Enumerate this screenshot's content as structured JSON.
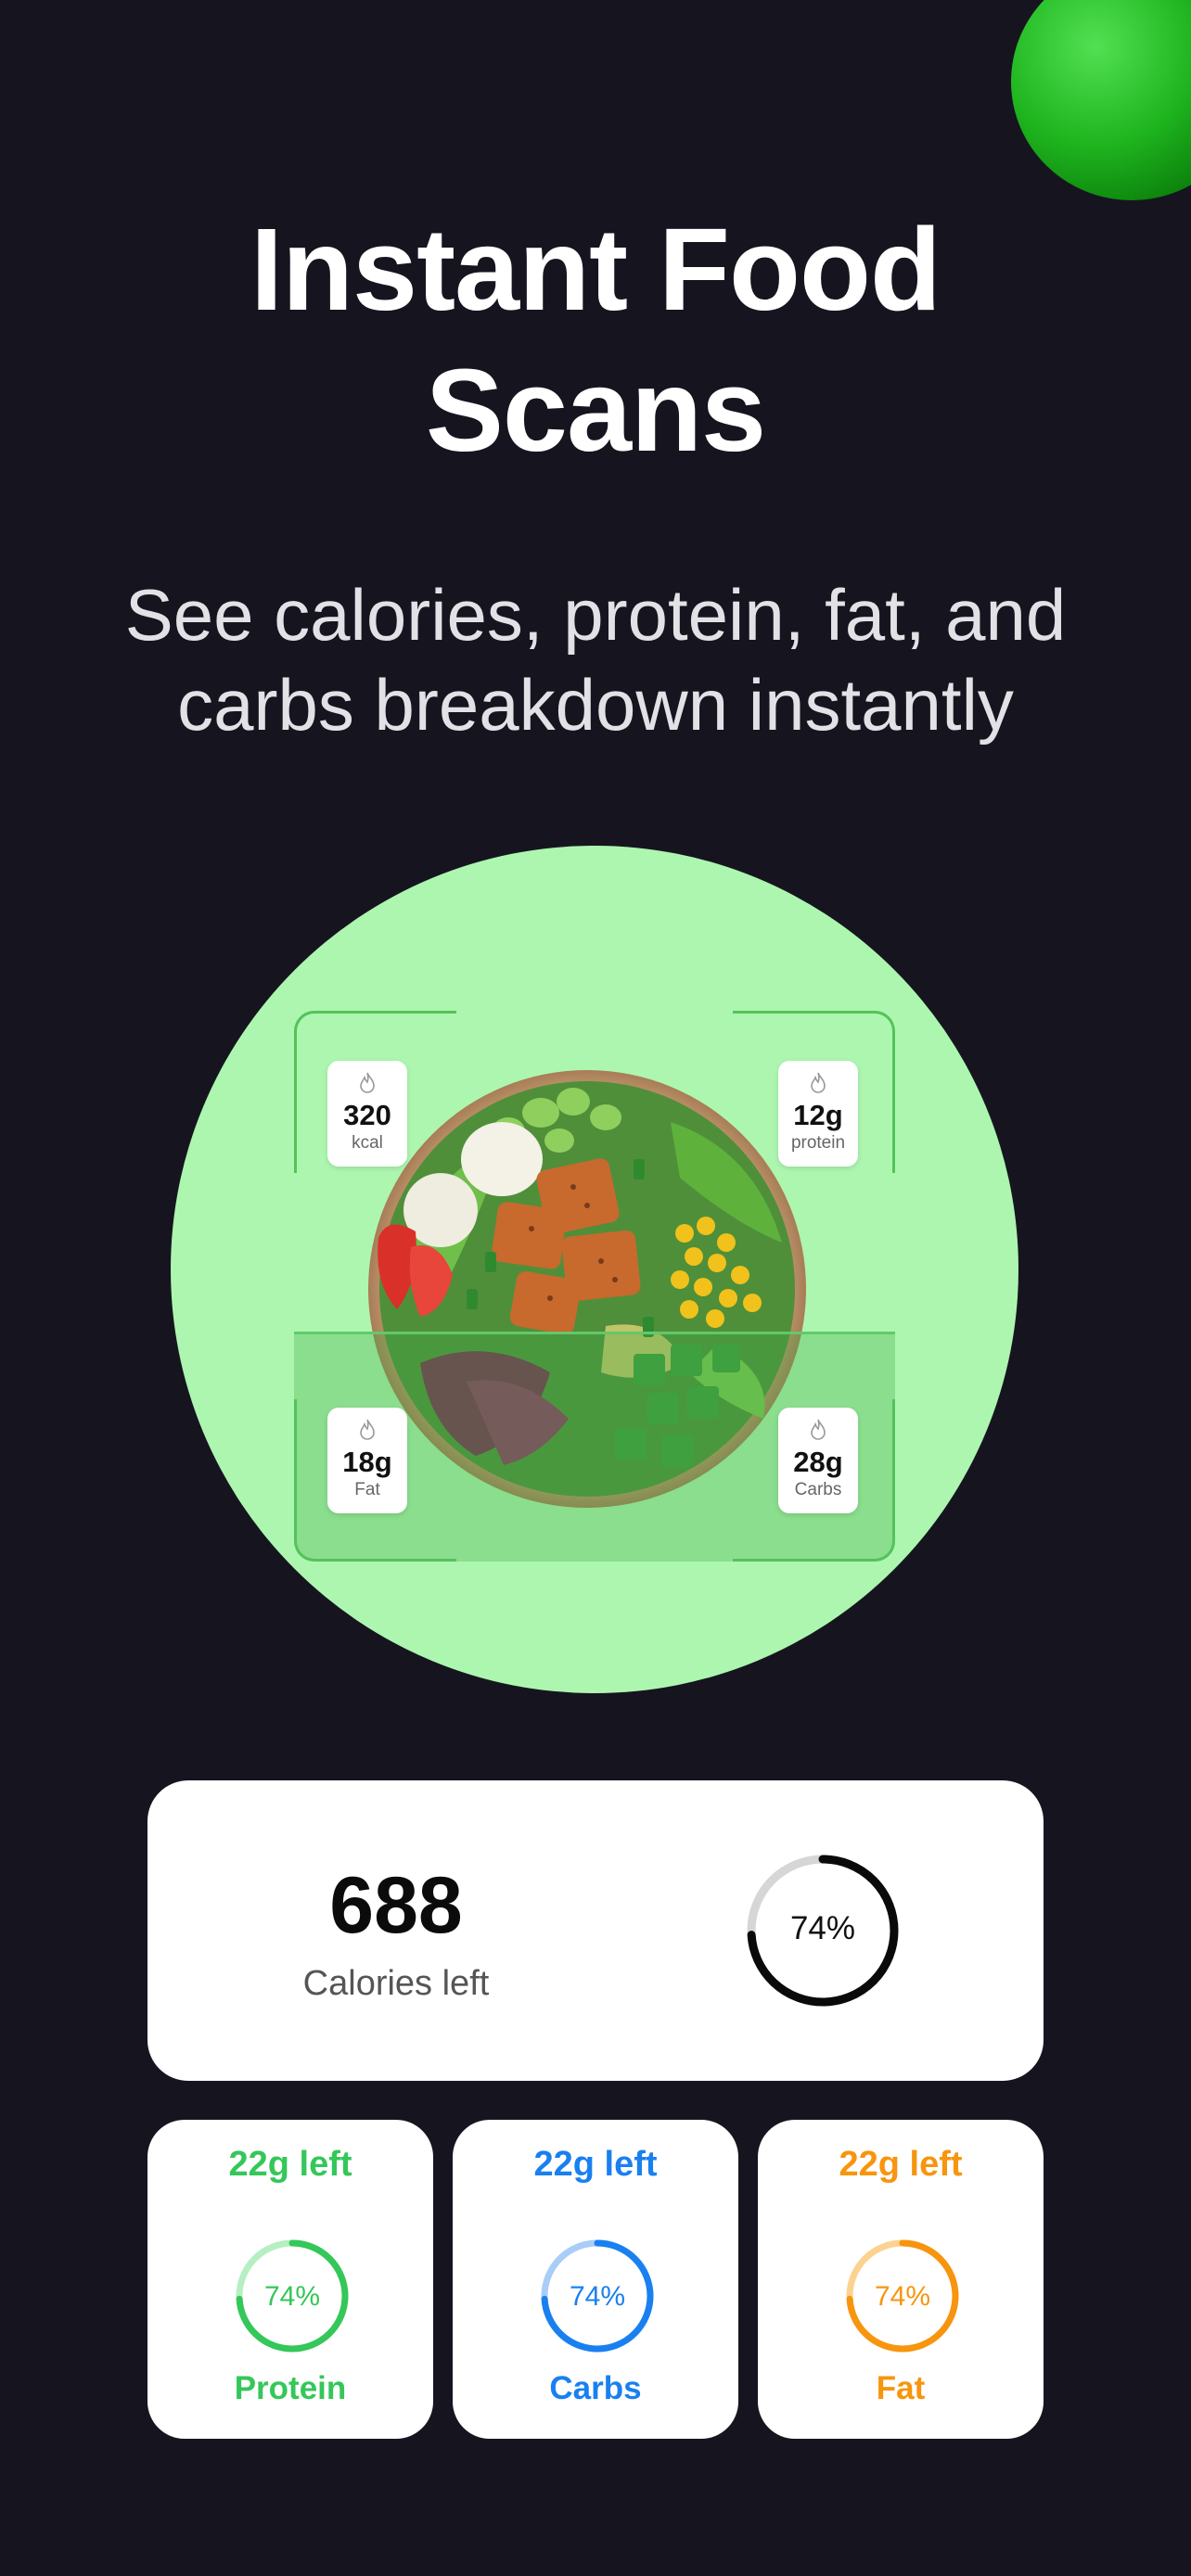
{
  "hero": {
    "title_line1": "Instant Food",
    "title_line2": "Scans",
    "subtitle_line1": "See calories, protein, fat, and",
    "subtitle_line2": "carbs breakdown instantly"
  },
  "scan": {
    "chips": [
      {
        "icon": "flame-icon",
        "value": "320",
        "unit": "kcal"
      },
      {
        "icon": "flame-icon",
        "value": "12g",
        "unit": "protein"
      },
      {
        "icon": "flame-icon",
        "value": "18g",
        "unit": "Fat"
      },
      {
        "icon": "flame-icon",
        "value": "28g",
        "unit": "Carbs"
      }
    ]
  },
  "calories": {
    "value": "688",
    "label": "Calories left",
    "percent_label": "74%",
    "progress": 0.74
  },
  "macros": [
    {
      "left": "22g left",
      "percent_label": "74%",
      "progress": 0.74,
      "name": "Protein",
      "color": "#34c759",
      "track": "#b6efc1"
    },
    {
      "left": "22g left",
      "percent_label": "74%",
      "progress": 0.74,
      "name": "Carbs",
      "color": "#1a80f0",
      "track": "#a8cdf7"
    },
    {
      "left": "22g left",
      "percent_label": "74%",
      "progress": 0.74,
      "name": "Fat",
      "color": "#f7950e",
      "track": "#fbd28f"
    }
  ],
  "colors": {
    "background": "#16151f",
    "scan_circle": "#adf6b0",
    "accent_green": "#34c759"
  }
}
